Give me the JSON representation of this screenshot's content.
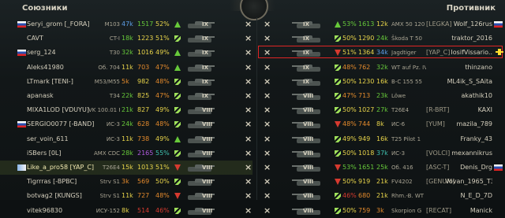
{
  "header": {
    "allies": "Союзники",
    "enemies": "Противник"
  },
  "colors": {
    "green": "#67c93a",
    "yellow": "#e8d44a",
    "orange": "#e38a2c",
    "red": "#d63a2f",
    "purple": "#b05be0",
    "teal": "#3fc1b0",
    "blue": "#5d9ee8"
  },
  "allies": [
    {
      "flag": "flag-ru",
      "name": "Seryi_grom [_FORA]",
      "tank": "M103",
      "battles": "47k",
      "wn": "1517",
      "wr": "52%",
      "arrow": "up",
      "lvl": "IX",
      "c_b": "#5d9ee8",
      "c_w": "#67c93a",
      "c_r": "#e8d44a"
    },
    {
      "flag": "",
      "name": "CAVT",
      "tank": "CT-I",
      "battles": "18k",
      "wn": "1223",
      "wr": "51%",
      "arrow": "dbl",
      "lvl": "IX",
      "c_b": "#67c93a",
      "c_w": "#e8d44a",
      "c_r": "#e8d44a"
    },
    {
      "flag": "flag-ru",
      "name": "serg_124",
      "tank": "T30",
      "battles": "32k",
      "wn": "1016",
      "wr": "49%",
      "arrow": "up",
      "lvl": "IX",
      "c_b": "#67c93a",
      "c_w": "#e8d44a",
      "c_r": "#e8d44a"
    },
    {
      "flag": "",
      "name": "Aleks41980",
      "tank": "Об. 704",
      "battles": "11k",
      "wn": "703",
      "wr": "47%",
      "arrow": "up",
      "lvl": "IX",
      "c_b": "#e8d44a",
      "c_w": "#e38a2c",
      "c_r": "#e38a2c"
    },
    {
      "flag": "",
      "name": "LTmark [TENI-]",
      "tank": "M53/M55",
      "battles": "5k",
      "wn": "982",
      "wr": "48%",
      "arrow": "sq",
      "lvl": "IX",
      "c_b": "#e38a2c",
      "c_w": "#e8d44a",
      "c_r": "#e38a2c"
    },
    {
      "flag": "",
      "name": "apanask",
      "tank": "T34",
      "battles": "22k",
      "wn": "825",
      "wr": "47%",
      "arrow": "dbl",
      "lvl": "IX",
      "c_b": "#67c93a",
      "c_w": "#e8d44a",
      "c_r": "#e38a2c"
    },
    {
      "flag": "",
      "name": "MIXA1LOD [VDUYU]",
      "tank": "VK 100.01 P",
      "battles": "21k",
      "wn": "827",
      "wr": "49%",
      "arrow": "dbl",
      "lvl": "VIII",
      "c_b": "#67c93a",
      "c_w": "#e8d44a",
      "c_r": "#e8d44a"
    },
    {
      "flag": "flag-ru",
      "name": "SERGIO0077 [-BAND]",
      "tank": "ИС-3",
      "battles": "24k",
      "wn": "628",
      "wr": "48%",
      "arrow": "dbl",
      "lvl": "VIII",
      "c_b": "#67c93a",
      "c_w": "#e38a2c",
      "c_r": "#e38a2c"
    },
    {
      "flag": "",
      "name": "ser_voin_611",
      "tank": "ИС-3",
      "battles": "11k",
      "wn": "738",
      "wr": "49%",
      "arrow": "up",
      "lvl": "VIII",
      "c_b": "#e8d44a",
      "c_w": "#e38a2c",
      "c_r": "#e8d44a"
    },
    {
      "flag": "",
      "name": "iSBers [0L]",
      "tank": "AMX CDC",
      "battles": "28k",
      "wn": "2165",
      "wr": "55%",
      "arrow": "dbl",
      "lvl": "VIII",
      "c_b": "#67c93a",
      "c_w": "#b05be0",
      "c_r": "#3fc1b0"
    },
    {
      "flag": "flag-other",
      "name": "Like_a_pro58 [YAP_C]",
      "tank": "T26E4",
      "battles": "15k",
      "wn": "1013",
      "wr": "51%",
      "arrow": "down",
      "lvl": "VIII",
      "c_b": "#e8d44a",
      "c_w": "#e8d44a",
      "c_r": "#e8d44a",
      "me": true
    },
    {
      "flag": "",
      "name": "Tigrrras [-BPBC]",
      "tank": "Strv S1",
      "battles": "3k",
      "wn": "569",
      "wr": "50%",
      "arrow": "dbl",
      "lvl": "VIII",
      "c_b": "#e38a2c",
      "c_w": "#e38a2c",
      "c_r": "#e8d44a"
    },
    {
      "flag": "",
      "name": "botvag2 [KUNGS]",
      "tank": "Strv S1",
      "battles": "11k",
      "wn": "727",
      "wr": "48%",
      "arrow": "down",
      "lvl": "VIII",
      "c_b": "#e8d44a",
      "c_w": "#e38a2c",
      "c_r": "#e38a2c"
    },
    {
      "flag": "",
      "name": "vitek96830",
      "tank": "ИСУ-152",
      "battles": "8k",
      "wn": "514",
      "wr": "46%",
      "arrow": "dbl",
      "lvl": "VIII",
      "c_b": "#e8d44a",
      "c_w": "#d63a2f",
      "c_r": "#d63a2f"
    }
  ],
  "enemies": [
    {
      "flag": "flag-ru",
      "name": "Wolf_126rus",
      "tank": "AMX 50 120",
      "clan": "[LEGKA]",
      "battles": "1613",
      "wn": "1613",
      "wr": "53%",
      "b": "12k",
      "arrow": "up",
      "lvl": "IX",
      "c_b": "#e8d44a",
      "c_w": "#67c93a",
      "c_r": "#67c93a"
    },
    {
      "flag": "",
      "name": "traktor_2016",
      "tank": "Škoda T 50",
      "clan": "",
      "battles": "1290",
      "wn": "1290",
      "wr": "50%",
      "b": "24k",
      "arrow": "dbl",
      "lvl": "IX",
      "c_b": "#67c93a",
      "c_w": "#e8d44a",
      "c_r": "#e8d44a"
    },
    {
      "flag": "",
      "name": "IosifVissario..",
      "tank": "Jagdtiger",
      "clan": "[YAP_C]",
      "battles": "1364",
      "wn": "1364",
      "wr": "51%",
      "b": "34k",
      "arrow": "down",
      "lvl": "IX",
      "c_b": "#5d9ee8",
      "c_w": "#e8d44a",
      "c_r": "#e8d44a"
    },
    {
      "flag": "",
      "name": "thinzano",
      "tank": "WT auf Pz. IV",
      "clan": "",
      "battles": "762",
      "wn": "762",
      "wr": "48%",
      "b": "32k",
      "arrow": "dbl",
      "lvl": "IX",
      "c_b": "#67c93a",
      "c_w": "#e38a2c",
      "c_r": "#e38a2c"
    },
    {
      "flag": "",
      "name": "ML4ik_S_SAita",
      "tank": "B-C 155 55",
      "clan": "",
      "battles": "1230",
      "wn": "1230",
      "wr": "50%",
      "b": "16k",
      "arrow": "dbl",
      "lvl": "IX",
      "c_b": "#e8d44a",
      "c_w": "#e8d44a",
      "c_r": "#e8d44a"
    },
    {
      "flag": "",
      "name": "akathik10",
      "tank": "Löwe",
      "clan": "",
      "battles": "713",
      "wn": "713",
      "wr": "47%",
      "b": "23k",
      "arrow": "dbl",
      "lvl": "VIII",
      "c_b": "#67c93a",
      "c_w": "#e38a2c",
      "c_r": "#e38a2c"
    },
    {
      "flag": "",
      "name": "KAXI",
      "tank": "T26E4",
      "clan": "[R-BRT]",
      "battles": "1027",
      "wn": "1027",
      "wr": "50%",
      "b": "27k",
      "arrow": "dbl",
      "lvl": "VIII",
      "c_b": "#67c93a",
      "c_w": "#e8d44a",
      "c_r": "#e8d44a"
    },
    {
      "flag": "",
      "name": "mazila_789",
      "tank": "ИС-6",
      "clan": "[YUM]",
      "battles": "744",
      "wn": "744",
      "wr": "48%",
      "b": "8k",
      "arrow": "down",
      "lvl": "VIII",
      "c_b": "#e8d44a",
      "c_w": "#e38a2c",
      "c_r": "#e38a2c"
    },
    {
      "flag": "",
      "name": "Franky_43",
      "tank": "T25 Pilot 1",
      "clan": "",
      "battles": "949",
      "wn": "949",
      "wr": "49%",
      "b": "16k",
      "arrow": "dbl",
      "lvl": "VIII",
      "c_b": "#e8d44a",
      "c_w": "#e8d44a",
      "c_r": "#e8d44a"
    },
    {
      "flag": "",
      "name": "mexannikrus",
      "tank": "ИС-3",
      "clan": "[VOLCI]",
      "battles": "1018",
      "wn": "1018",
      "wr": "50%",
      "b": "37k",
      "arrow": "dbl",
      "lvl": "VIII",
      "c_b": "#3fc1b0",
      "c_w": "#e8d44a",
      "c_r": "#e8d44a"
    },
    {
      "flag": "flag-ru",
      "name": "Denis_Drg",
      "tank": "Об. 416",
      "clan": "[ASC-T]",
      "battles": "1651",
      "wn": "1651",
      "wr": "53%",
      "b": "25k",
      "arrow": "down",
      "lvl": "VIII",
      "c_b": "#67c93a",
      "c_w": "#67c93a",
      "c_r": "#67c93a"
    },
    {
      "flag": "",
      "name": "Vovan_1965_T34",
      "tank": "FV4202",
      "clan": "[GENUM]",
      "battles": "919",
      "wn": "919",
      "wr": "50%",
      "b": "21k",
      "arrow": "down",
      "lvl": "VIII",
      "c_b": "#e8d44a",
      "c_w": "#e8d44a",
      "c_r": "#e8d44a"
    },
    {
      "flag": "",
      "name": "N_E_D_7D",
      "tank": "Rhm.-B. WT",
      "clan": "",
      "battles": "680",
      "wn": "680",
      "wr": "46%",
      "b": "21k",
      "arrow": "dbl",
      "lvl": "VIII",
      "c_b": "#e8d44a",
      "c_w": "#e38a2c",
      "c_r": "#d63a2f"
    },
    {
      "flag": "",
      "name": "Manick",
      "tank": "Skorpion G",
      "clan": "[RECAT]",
      "battles": "759",
      "wn": "759",
      "wr": "50%",
      "b": "3k",
      "arrow": "dbl",
      "lvl": "VIII",
      "c_b": "#e38a2c",
      "c_w": "#e38a2c",
      "c_r": "#e8d44a"
    }
  ]
}
